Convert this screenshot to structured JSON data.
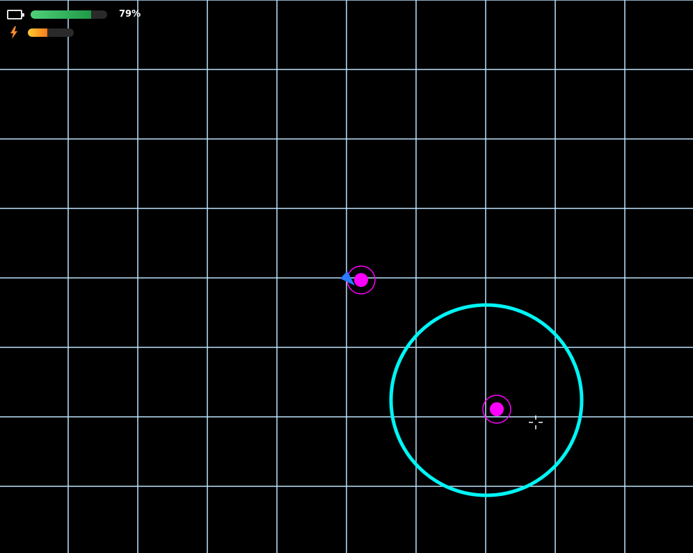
{
  "hud": {
    "battery": {
      "icon": "battery-icon",
      "level": 0.79,
      "percent_label": "79%",
      "fill_color": "#2fb35c"
    },
    "energy": {
      "icon": "lightning-bolt-icon",
      "level": 0.42,
      "fill_color": "#ff9a2a"
    }
  },
  "colors": {
    "background": "#000000",
    "grid": "#bfe6ff",
    "zone_ring": "#00f5f5",
    "target": "#ff00ff",
    "player": "#2a7bff",
    "crosshair": "#ffffff"
  },
  "entities": {
    "zone": {
      "name": "cyan-ring"
    },
    "targets": [
      {
        "name": "magenta-target"
      },
      {
        "name": "magenta-target"
      }
    ],
    "player": {
      "name": "blue-arrow-ship"
    },
    "crosshair": {
      "name": "crosshair-icon"
    }
  }
}
